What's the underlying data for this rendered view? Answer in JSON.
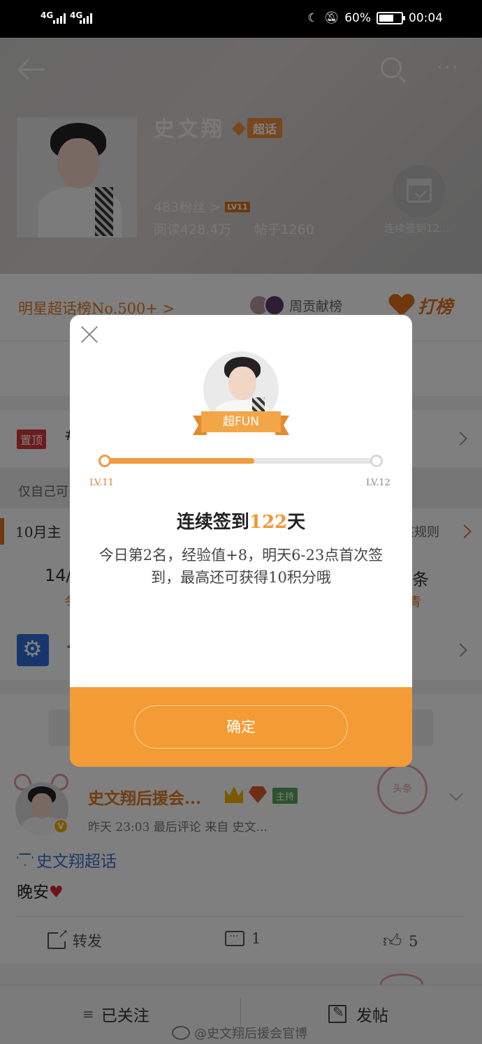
{
  "status_bar": {
    "network1": "4G",
    "network2": "4G",
    "battery": "60%",
    "time": "00:04"
  },
  "header": {
    "title": "史文翔",
    "badge": "超话",
    "fans": "483粉丝 >",
    "level": "LV11",
    "reads": "阅读428.4万",
    "posts": "帖子1260",
    "checkin_label": "连续签到12..."
  },
  "rank_bar": {
    "rank": "明星超话榜No.500+ >",
    "contribution": "周贡献榜",
    "vote": "打榜"
  },
  "rows": {
    "pin_badge": "置顶",
    "pin_text": "#",
    "self_visible": "仅自己可",
    "month_title": "10月主",
    "rules": "核规则",
    "stat_left": "14/",
    "stat_right": "条",
    "stat_left_sub": "冬",
    "stat_right_sub": "青",
    "settings_text": "<"
  },
  "modal": {
    "ribbon": "超FUN",
    "level_from": "LV.11",
    "level_to": "LV.12",
    "progress": 0.55,
    "title_prefix": "连续签到",
    "title_days": "122",
    "title_suffix": "天",
    "description": "今日第2名，经验值+8，明天6-23点首次签到，最高还可获得10积分哦",
    "confirm": "确定"
  },
  "post": {
    "author": "史文翔后援会...",
    "host_badge": "主持",
    "meta": "昨天 23:03 最后评论  来自 史文...",
    "topic": "史文翔超话",
    "body": "晚安",
    "stamp": "头条",
    "share": "转发",
    "comments": "1",
    "likes": "5"
  },
  "bottom_nav": {
    "following": "已关注",
    "post": "发帖"
  },
  "watermark": "@史文翔后援会官博",
  "colors": {
    "accent": "#f39b34",
    "rank_orange": "#e07b22",
    "topic_blue": "#3c73c4"
  }
}
